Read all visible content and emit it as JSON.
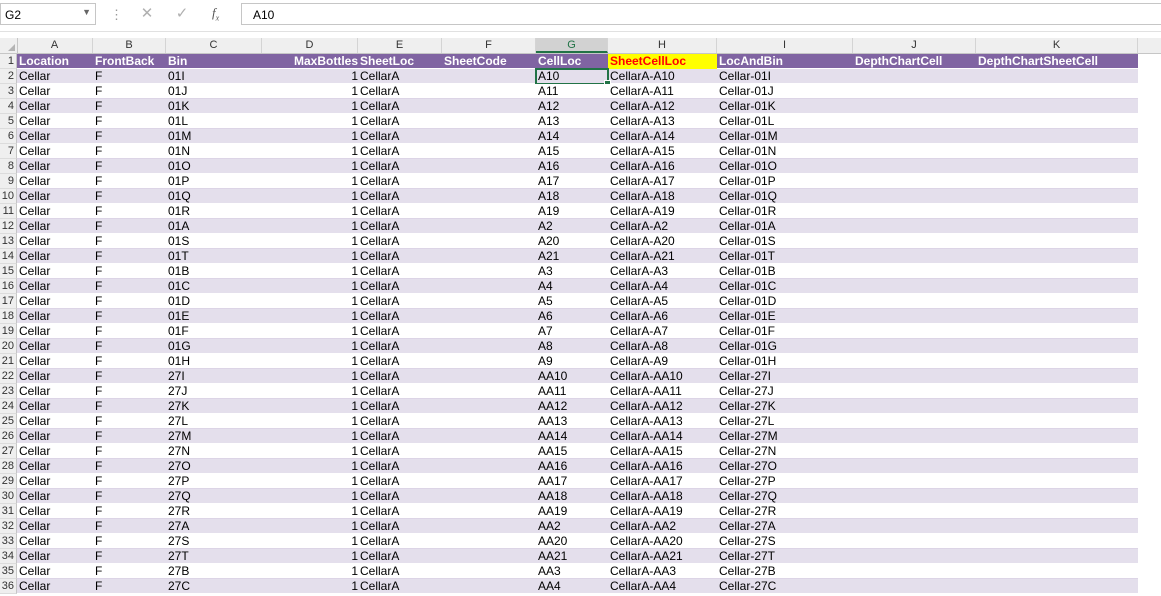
{
  "name_box": "G2",
  "formula_value": "A10",
  "columns": [
    "A",
    "B",
    "C",
    "D",
    "E",
    "F",
    "G",
    "H",
    "I",
    "J",
    "K"
  ],
  "selected_column": "G",
  "header_row": {
    "row_number": "1",
    "cells": [
      "Location",
      "FrontBack",
      "Bin",
      "",
      "MaxBottles",
      "SheetLoc",
      "SheetCode",
      "CellLoc",
      "SheetCellLoc",
      "LocAndBin",
      "DepthChartCell",
      "DepthChartSheetCell"
    ]
  },
  "rows": [
    {
      "n": "2",
      "loc": "Cellar",
      "fb": "F",
      "bin": "01I",
      "max": "1",
      "sheet": "CellarA",
      "cell": "A10",
      "scl": "CellarA-A10",
      "lab": "Cellar-01I"
    },
    {
      "n": "3",
      "loc": "Cellar",
      "fb": "F",
      "bin": "01J",
      "max": "1",
      "sheet": "CellarA",
      "cell": "A11",
      "scl": "CellarA-A11",
      "lab": "Cellar-01J"
    },
    {
      "n": "4",
      "loc": "Cellar",
      "fb": "F",
      "bin": "01K",
      "max": "1",
      "sheet": "CellarA",
      "cell": "A12",
      "scl": "CellarA-A12",
      "lab": "Cellar-01K"
    },
    {
      "n": "5",
      "loc": "Cellar",
      "fb": "F",
      "bin": "01L",
      "max": "1",
      "sheet": "CellarA",
      "cell": "A13",
      "scl": "CellarA-A13",
      "lab": "Cellar-01L"
    },
    {
      "n": "6",
      "loc": "Cellar",
      "fb": "F",
      "bin": "01M",
      "max": "1",
      "sheet": "CellarA",
      "cell": "A14",
      "scl": "CellarA-A14",
      "lab": "Cellar-01M"
    },
    {
      "n": "7",
      "loc": "Cellar",
      "fb": "F",
      "bin": "01N",
      "max": "1",
      "sheet": "CellarA",
      "cell": "A15",
      "scl": "CellarA-A15",
      "lab": "Cellar-01N"
    },
    {
      "n": "8",
      "loc": "Cellar",
      "fb": "F",
      "bin": "01O",
      "max": "1",
      "sheet": "CellarA",
      "cell": "A16",
      "scl": "CellarA-A16",
      "lab": "Cellar-01O"
    },
    {
      "n": "9",
      "loc": "Cellar",
      "fb": "F",
      "bin": "01P",
      "max": "1",
      "sheet": "CellarA",
      "cell": "A17",
      "scl": "CellarA-A17",
      "lab": "Cellar-01P"
    },
    {
      "n": "10",
      "loc": "Cellar",
      "fb": "F",
      "bin": "01Q",
      "max": "1",
      "sheet": "CellarA",
      "cell": "A18",
      "scl": "CellarA-A18",
      "lab": "Cellar-01Q"
    },
    {
      "n": "11",
      "loc": "Cellar",
      "fb": "F",
      "bin": "01R",
      "max": "1",
      "sheet": "CellarA",
      "cell": "A19",
      "scl": "CellarA-A19",
      "lab": "Cellar-01R"
    },
    {
      "n": "12",
      "loc": "Cellar",
      "fb": "F",
      "bin": "01A",
      "max": "1",
      "sheet": "CellarA",
      "cell": "A2",
      "scl": "CellarA-A2",
      "lab": "Cellar-01A"
    },
    {
      "n": "13",
      "loc": "Cellar",
      "fb": "F",
      "bin": "01S",
      "max": "1",
      "sheet": "CellarA",
      "cell": "A20",
      "scl": "CellarA-A20",
      "lab": "Cellar-01S"
    },
    {
      "n": "14",
      "loc": "Cellar",
      "fb": "F",
      "bin": "01T",
      "max": "1",
      "sheet": "CellarA",
      "cell": "A21",
      "scl": "CellarA-A21",
      "lab": "Cellar-01T"
    },
    {
      "n": "15",
      "loc": "Cellar",
      "fb": "F",
      "bin": "01B",
      "max": "1",
      "sheet": "CellarA",
      "cell": "A3",
      "scl": "CellarA-A3",
      "lab": "Cellar-01B"
    },
    {
      "n": "16",
      "loc": "Cellar",
      "fb": "F",
      "bin": "01C",
      "max": "1",
      "sheet": "CellarA",
      "cell": "A4",
      "scl": "CellarA-A4",
      "lab": "Cellar-01C"
    },
    {
      "n": "17",
      "loc": "Cellar",
      "fb": "F",
      "bin": "01D",
      "max": "1",
      "sheet": "CellarA",
      "cell": "A5",
      "scl": "CellarA-A5",
      "lab": "Cellar-01D"
    },
    {
      "n": "18",
      "loc": "Cellar",
      "fb": "F",
      "bin": "01E",
      "max": "1",
      "sheet": "CellarA",
      "cell": "A6",
      "scl": "CellarA-A6",
      "lab": "Cellar-01E"
    },
    {
      "n": "19",
      "loc": "Cellar",
      "fb": "F",
      "bin": "01F",
      "max": "1",
      "sheet": "CellarA",
      "cell": "A7",
      "scl": "CellarA-A7",
      "lab": "Cellar-01F"
    },
    {
      "n": "20",
      "loc": "Cellar",
      "fb": "F",
      "bin": "01G",
      "max": "1",
      "sheet": "CellarA",
      "cell": "A8",
      "scl": "CellarA-A8",
      "lab": "Cellar-01G"
    },
    {
      "n": "21",
      "loc": "Cellar",
      "fb": "F",
      "bin": "01H",
      "max": "1",
      "sheet": "CellarA",
      "cell": "A9",
      "scl": "CellarA-A9",
      "lab": "Cellar-01H"
    },
    {
      "n": "22",
      "loc": "Cellar",
      "fb": "F",
      "bin": "27I",
      "max": "1",
      "sheet": "CellarA",
      "cell": "AA10",
      "scl": "CellarA-AA10",
      "lab": "Cellar-27I"
    },
    {
      "n": "23",
      "loc": "Cellar",
      "fb": "F",
      "bin": "27J",
      "max": "1",
      "sheet": "CellarA",
      "cell": "AA11",
      "scl": "CellarA-AA11",
      "lab": "Cellar-27J"
    },
    {
      "n": "24",
      "loc": "Cellar",
      "fb": "F",
      "bin": "27K",
      "max": "1",
      "sheet": "CellarA",
      "cell": "AA12",
      "scl": "CellarA-AA12",
      "lab": "Cellar-27K"
    },
    {
      "n": "25",
      "loc": "Cellar",
      "fb": "F",
      "bin": "27L",
      "max": "1",
      "sheet": "CellarA",
      "cell": "AA13",
      "scl": "CellarA-AA13",
      "lab": "Cellar-27L"
    },
    {
      "n": "26",
      "loc": "Cellar",
      "fb": "F",
      "bin": "27M",
      "max": "1",
      "sheet": "CellarA",
      "cell": "AA14",
      "scl": "CellarA-AA14",
      "lab": "Cellar-27M"
    },
    {
      "n": "27",
      "loc": "Cellar",
      "fb": "F",
      "bin": "27N",
      "max": "1",
      "sheet": "CellarA",
      "cell": "AA15",
      "scl": "CellarA-AA15",
      "lab": "Cellar-27N"
    },
    {
      "n": "28",
      "loc": "Cellar",
      "fb": "F",
      "bin": "27O",
      "max": "1",
      "sheet": "CellarA",
      "cell": "AA16",
      "scl": "CellarA-AA16",
      "lab": "Cellar-27O"
    },
    {
      "n": "29",
      "loc": "Cellar",
      "fb": "F",
      "bin": "27P",
      "max": "1",
      "sheet": "CellarA",
      "cell": "AA17",
      "scl": "CellarA-AA17",
      "lab": "Cellar-27P"
    },
    {
      "n": "30",
      "loc": "Cellar",
      "fb": "F",
      "bin": "27Q",
      "max": "1",
      "sheet": "CellarA",
      "cell": "AA18",
      "scl": "CellarA-AA18",
      "lab": "Cellar-27Q"
    },
    {
      "n": "31",
      "loc": "Cellar",
      "fb": "F",
      "bin": "27R",
      "max": "1",
      "sheet": "CellarA",
      "cell": "AA19",
      "scl": "CellarA-AA19",
      "lab": "Cellar-27R"
    },
    {
      "n": "32",
      "loc": "Cellar",
      "fb": "F",
      "bin": "27A",
      "max": "1",
      "sheet": "CellarA",
      "cell": "AA2",
      "scl": "CellarA-AA2",
      "lab": "Cellar-27A"
    },
    {
      "n": "33",
      "loc": "Cellar",
      "fb": "F",
      "bin": "27S",
      "max": "1",
      "sheet": "CellarA",
      "cell": "AA20",
      "scl": "CellarA-AA20",
      "lab": "Cellar-27S"
    },
    {
      "n": "34",
      "loc": "Cellar",
      "fb": "F",
      "bin": "27T",
      "max": "1",
      "sheet": "CellarA",
      "cell": "AA21",
      "scl": "CellarA-AA21",
      "lab": "Cellar-27T"
    },
    {
      "n": "35",
      "loc": "Cellar",
      "fb": "F",
      "bin": "27B",
      "max": "1",
      "sheet": "CellarA",
      "cell": "AA3",
      "scl": "CellarA-AA3",
      "lab": "Cellar-27B"
    },
    {
      "n": "36",
      "loc": "Cellar",
      "fb": "F",
      "bin": "27C",
      "max": "1",
      "sheet": "CellarA",
      "cell": "AA4",
      "scl": "CellarA-AA4",
      "lab": "Cellar-27C"
    }
  ]
}
